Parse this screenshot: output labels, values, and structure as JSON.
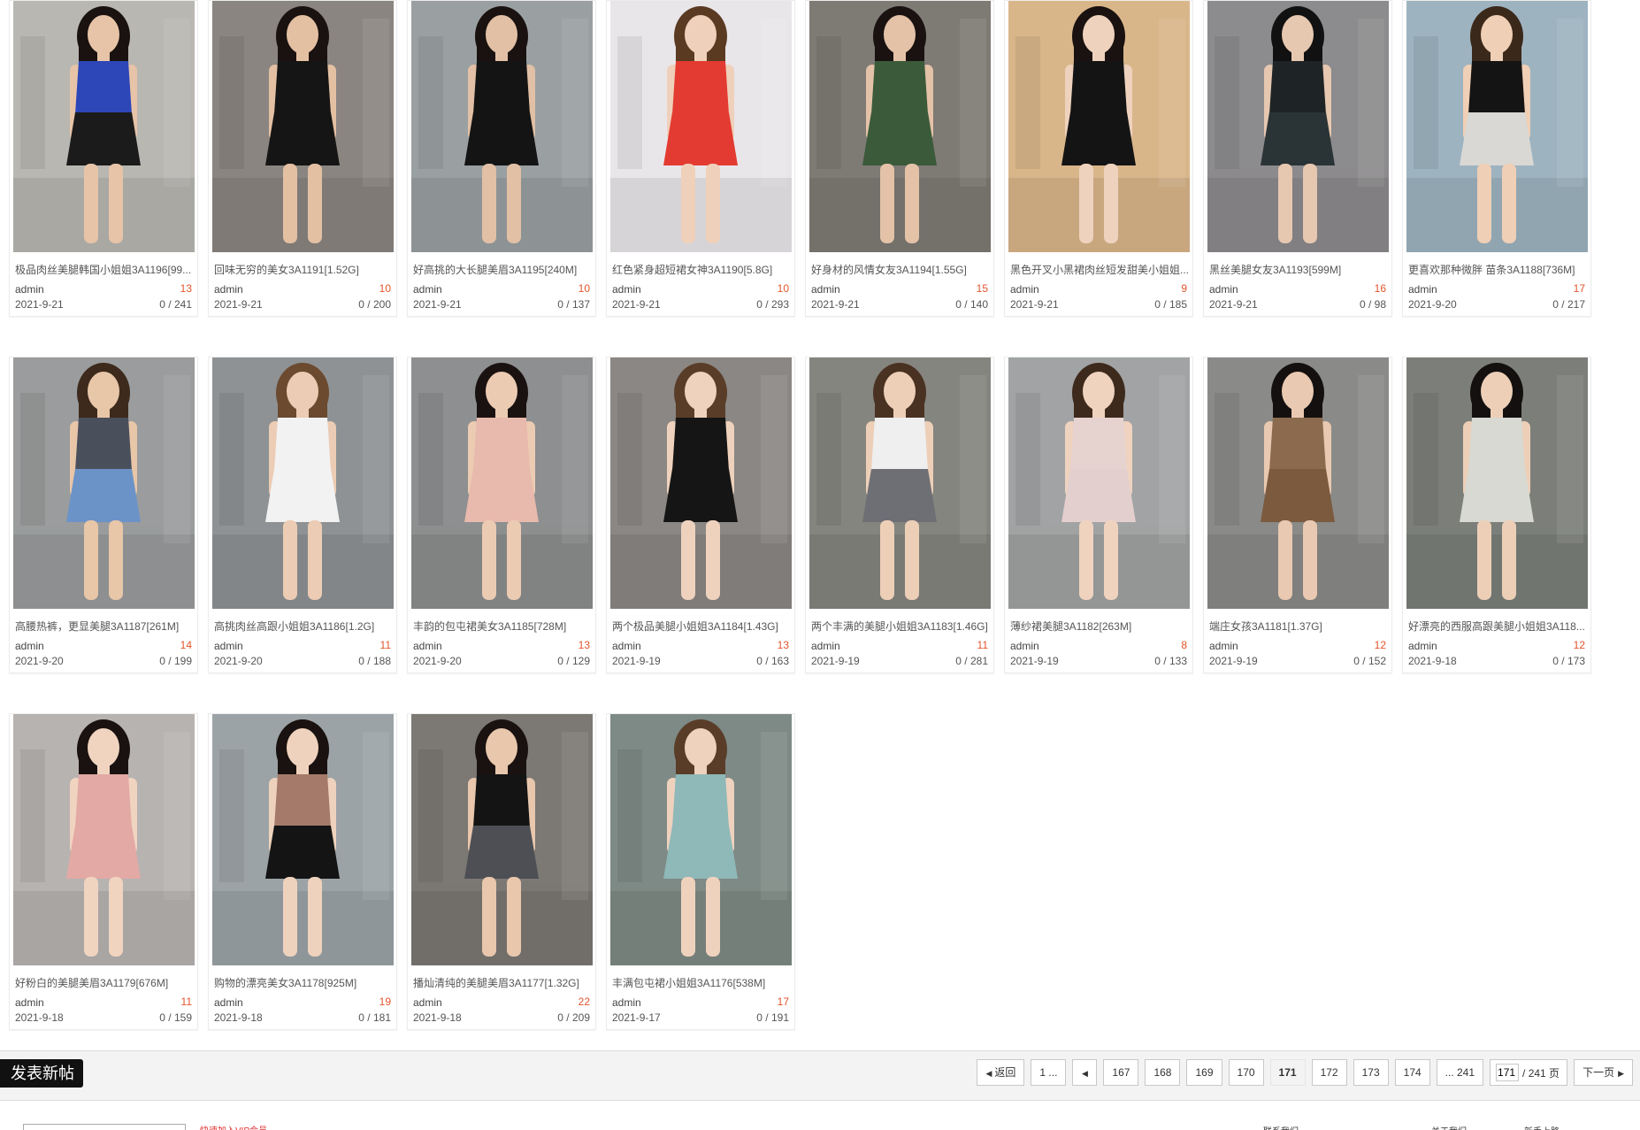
{
  "cards": [
    {
      "title": "极品肉丝美腿韩国小姐姐3A1196[99...",
      "author": "admin",
      "count": "13",
      "date": "2021-9-21",
      "stats": "0 / 241",
      "palette": {
        "bg": "#b9b7b1",
        "top": "#2d47b8",
        "bottom": "#1b1b1b",
        "skin": "#e7c4a8",
        "hair": "#1a1210"
      }
    },
    {
      "title": "回味无穷的美女3A1191[1.52G]",
      "author": "admin",
      "count": "10",
      "date": "2021-9-21",
      "stats": "0 / 200",
      "palette": {
        "bg": "#8a8580",
        "top": "#151515",
        "bottom": "#151515",
        "skin": "#e4c0a3",
        "hair": "#1a1210"
      }
    },
    {
      "title": "好高挑的大长腿美眉3A1195[240M]",
      "author": "admin",
      "count": "10",
      "date": "2021-9-21",
      "stats": "0 / 137",
      "palette": {
        "bg": "#9aa0a2",
        "top": "#141414",
        "bottom": "#141414",
        "skin": "#e2c0a5",
        "hair": "#1a1210"
      }
    },
    {
      "title": "红色紧身超短裙女神3A1190[5.8G]",
      "author": "admin",
      "count": "10",
      "date": "2021-9-21",
      "stats": "0 / 293",
      "palette": {
        "bg": "#e9e6ea",
        "top": "#e33b31",
        "bottom": "#e33b31",
        "skin": "#efd0ba",
        "hair": "#5a3b22"
      }
    },
    {
      "title": "好身材的风情女友3A1194[1.55G]",
      "author": "admin",
      "count": "15",
      "date": "2021-9-21",
      "stats": "0 / 140",
      "palette": {
        "bg": "#7e7a74",
        "top": "#3b5a3a",
        "bottom": "#3b5a3a",
        "skin": "#e3c2a8",
        "hair": "#1a1210"
      }
    },
    {
      "title": "黑色开叉小黑裙肉丝短发甜美小姐姐...",
      "author": "admin",
      "count": "9",
      "date": "2021-9-21",
      "stats": "0 / 185",
      "palette": {
        "bg": "#d9b68a",
        "top": "#141414",
        "bottom": "#141414",
        "skin": "#efd2bd",
        "hair": "#1a1210"
      }
    },
    {
      "title": "黑丝美腿女友3A1193[599M]",
      "author": "admin",
      "count": "16",
      "date": "2021-9-21",
      "stats": "0 / 98",
      "palette": {
        "bg": "#8c8b8d",
        "top": "#1e2426",
        "bottom": "#2a3336",
        "skin": "#e6c7b0",
        "hair": "#111111"
      }
    },
    {
      "title": "更喜欢那种微胖 苗条3A1188[736M]",
      "author": "admin",
      "count": "17",
      "date": "2021-9-20",
      "stats": "0 / 217",
      "palette": {
        "bg": "#9eb3c0",
        "top": "#141414",
        "bottom": "#d9d8d4",
        "skin": "#efcfb5",
        "hair": "#3a281a"
      }
    },
    {
      "title": "高腰热裤，更显美腿3A1187[261M]",
      "author": "admin",
      "count": "14",
      "date": "2021-9-20",
      "stats": "0 / 199",
      "palette": {
        "bg": "#9a9c9d",
        "top": "#4a4f5c",
        "bottom": "#6b93c8",
        "skin": "#e8c6a8",
        "hair": "#3d2a1c"
      }
    },
    {
      "title": "高挑肉丝高跟小姐姐3A1186[1.2G]",
      "author": "admin",
      "count": "11",
      "date": "2021-9-20",
      "stats": "0 / 188",
      "palette": {
        "bg": "#8e9294",
        "top": "#f2f2f2",
        "bottom": "#f2f2f2",
        "skin": "#ecccb4",
        "hair": "#6b4a30"
      }
    },
    {
      "title": "丰韵的包屯裙美女3A1185[728M]",
      "author": "admin",
      "count": "13",
      "date": "2021-9-20",
      "stats": "0 / 129",
      "palette": {
        "bg": "#8d8f90",
        "top": "#e8b9ad",
        "bottom": "#e8b9ad",
        "skin": "#eccbb3",
        "hair": "#1a1210"
      }
    },
    {
      "title": "两个极品美腿小姐姐3A1184[1.43G]",
      "author": "admin",
      "count": "13",
      "date": "2021-9-19",
      "stats": "0 / 163",
      "palette": {
        "bg": "#8a8784",
        "top": "#151515",
        "bottom": "#151515",
        "skin": "#efd2bd",
        "hair": "#5a3d28"
      }
    },
    {
      "title": "两个丰满的美腿小姐姐3A1183[1.46G]",
      "author": "admin",
      "count": "11",
      "date": "2021-9-19",
      "stats": "0 / 281",
      "palette": {
        "bg": "#85857f",
        "top": "#efefef",
        "bottom": "#6e6f74",
        "skin": "#edcfb8",
        "hair": "#4a3222"
      }
    },
    {
      "title": "薄纱裙美腿3A1182[263M]",
      "author": "admin",
      "count": "8",
      "date": "2021-9-19",
      "stats": "0 / 133",
      "palette": {
        "bg": "#a1a3a4",
        "top": "#e6d2cf",
        "bottom": "#e3cfcd",
        "skin": "#efd3bf",
        "hair": "#3d2a1c"
      }
    },
    {
      "title": "端庄女孩3A1181[1.37G]",
      "author": "admin",
      "count": "12",
      "date": "2021-9-19",
      "stats": "0 / 152",
      "palette": {
        "bg": "#8a8b88",
        "top": "#8c6a4e",
        "bottom": "#7b5a3e",
        "skin": "#e9c9b1",
        "hair": "#141010"
      }
    },
    {
      "title": "好漂亮的西服高跟美腿小姐姐3A118...",
      "author": "admin",
      "count": "12",
      "date": "2021-9-18",
      "stats": "0 / 173",
      "palette": {
        "bg": "#7c7f79",
        "top": "#d8d9d2",
        "bottom": "#d8d9d2",
        "skin": "#edcfb8",
        "hair": "#141010"
      }
    },
    {
      "title": "好粉白的美腿美眉3A1179[676M]",
      "author": "admin",
      "count": "11",
      "date": "2021-9-18",
      "stats": "0 / 159",
      "palette": {
        "bg": "#b7b3b1",
        "top": "#e3a9a5",
        "bottom": "#e3a9a5",
        "skin": "#f0d4c0",
        "hair": "#1a1210"
      }
    },
    {
      "title": "购物的漂亮美女3A1178[925M]",
      "author": "admin",
      "count": "19",
      "date": "2021-9-18",
      "stats": "0 / 181",
      "palette": {
        "bg": "#9ca3a6",
        "top": "#a57a6a",
        "bottom": "#141414",
        "skin": "#efd2bd",
        "hair": "#1a1210"
      }
    },
    {
      "title": "播灿清纯的美腿美眉3A1177[1.32G]",
      "author": "admin",
      "count": "22",
      "date": "2021-9-18",
      "stats": "0 / 209",
      "palette": {
        "bg": "#7c7873",
        "top": "#141414",
        "bottom": "#4d4f55",
        "skin": "#e8c7ad",
        "hair": "#1a1210"
      }
    },
    {
      "title": "丰满包屯裙小姐姐3A1176[538M]",
      "author": "admin",
      "count": "17",
      "date": "2021-9-17",
      "stats": "0 / 191",
      "palette": {
        "bg": "#7e8a86",
        "top": "#8fb8b8",
        "bottom": "#8fb8b8",
        "skin": "#efd2bd",
        "hair": "#5a3d28"
      }
    }
  ],
  "toolbar": {
    "new_post_label": "发表新帖"
  },
  "pagination": {
    "back_label": "返回",
    "first_label": "1 ...",
    "pages": [
      "167",
      "168",
      "169",
      "170",
      "171",
      "172",
      "173",
      "174"
    ],
    "current_page": "171",
    "last_label": "... 241",
    "page_input_value": "171",
    "total_label": "/ 241 页",
    "next_label": "下一页"
  },
  "footer": {
    "link_text": "快速加入VIP会员",
    "right_1": "联系我们",
    "right_2": "关于我们",
    "right_3": "新手上路"
  }
}
